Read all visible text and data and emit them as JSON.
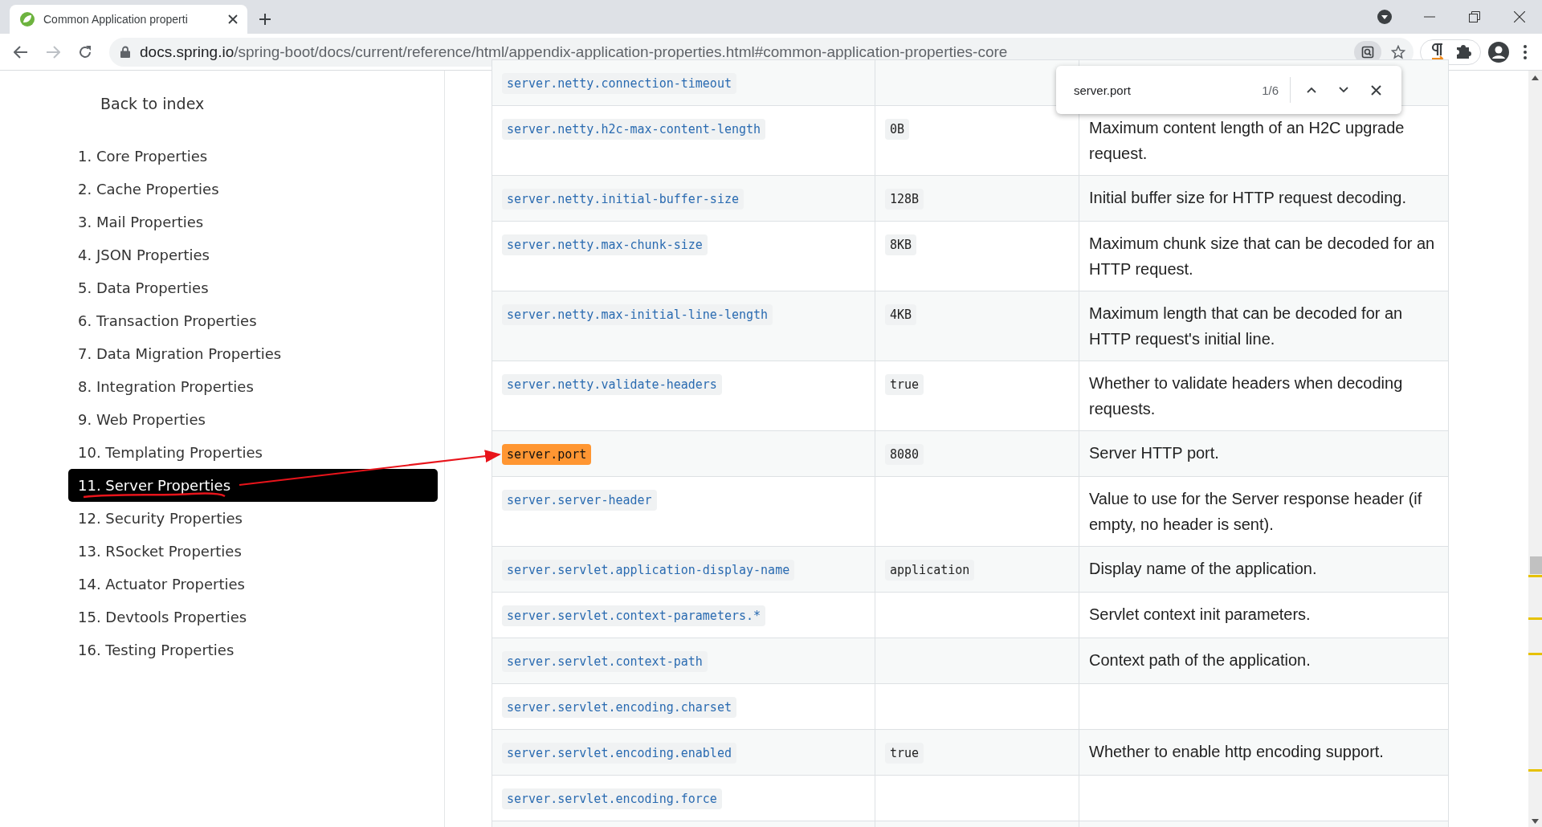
{
  "browser": {
    "tab_title": "Common Application properti",
    "url_host": "docs.spring.io",
    "url_path": "/spring-boot/docs/current/reference/html/appendix-application-properties.html#common-application-properties-core"
  },
  "find_bar": {
    "value": "server.port",
    "count": "1/6"
  },
  "sidebar": {
    "back_link": "Back to index",
    "items": [
      {
        "label": "1. Core Properties",
        "selected": false
      },
      {
        "label": "2. Cache Properties",
        "selected": false
      },
      {
        "label": "3. Mail Properties",
        "selected": false
      },
      {
        "label": "4. JSON Properties",
        "selected": false
      },
      {
        "label": "5. Data Properties",
        "selected": false
      },
      {
        "label": "6. Transaction Properties",
        "selected": false
      },
      {
        "label": "7. Data Migration Properties",
        "selected": false
      },
      {
        "label": "8. Integration Properties",
        "selected": false
      },
      {
        "label": "9. Web Properties",
        "selected": false
      },
      {
        "label": "10. Templating Properties",
        "selected": false
      },
      {
        "label": "11. Server Properties",
        "selected": true
      },
      {
        "label": "12. Security Properties",
        "selected": false
      },
      {
        "label": "13. RSocket Properties",
        "selected": false
      },
      {
        "label": "14. Actuator Properties",
        "selected": false
      },
      {
        "label": "15. Devtools Properties",
        "selected": false
      },
      {
        "label": "16. Testing Properties",
        "selected": false
      }
    ]
  },
  "table": {
    "rows": [
      {
        "name": "server.netty.connection-timeout",
        "highlighted": false
      },
      {
        "name": "server.netty.h2c-max-content-length",
        "default": "0B",
        "description": "Maximum content length of an H2C upgrade request.",
        "highlighted": false
      },
      {
        "name": "server.netty.initial-buffer-size",
        "default": "128B",
        "description": "Initial buffer size for HTTP request decoding.",
        "highlighted": false
      },
      {
        "name": "server.netty.max-chunk-size",
        "default": "8KB",
        "description": "Maximum chunk size that can be decoded for an HTTP request.",
        "highlighted": false
      },
      {
        "name": "server.netty.max-initial-line-length",
        "default": "4KB",
        "description": "Maximum length that can be decoded for an HTTP request's initial line.",
        "highlighted": false
      },
      {
        "name": "server.netty.validate-headers",
        "default": "true",
        "description": "Whether to validate headers when decoding requests.",
        "highlighted": false
      },
      {
        "name": "server.port",
        "default": "8080",
        "description": "Server HTTP port.",
        "highlighted": true
      },
      {
        "name": "server.server-header",
        "description": "Value to use for the Server response header (if empty, no header is sent).",
        "highlighted": false
      },
      {
        "name": "server.servlet.application-display-name",
        "default": "application",
        "description": "Display name of the application.",
        "highlighted": false
      },
      {
        "name": "server.servlet.context-parameters.*",
        "description": "Servlet context init parameters.",
        "highlighted": false
      },
      {
        "name": "server.servlet.context-path",
        "description": "Context path of the application.",
        "highlighted": false
      },
      {
        "name": "server.servlet.encoding.charset",
        "highlighted": false
      },
      {
        "name": "server.servlet.encoding.enabled",
        "default": "true",
        "description": "Whether to enable http encoding support.",
        "highlighted": false
      },
      {
        "name": "server.servlet.encoding.force",
        "highlighted": false
      }
    ]
  }
}
